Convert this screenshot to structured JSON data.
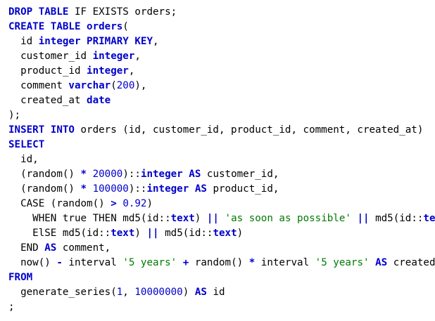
{
  "editor": {
    "theme": {
      "keyword_color": "#0000cc",
      "number_color": "#0000cc",
      "string_color": "#007a00",
      "text_color": "#000000",
      "background": "#ffffff"
    },
    "lines": [
      [
        {
          "t": "kw",
          "v": "DROP TABLE"
        },
        {
          "t": "plain",
          "v": " IF EXISTS orders;"
        }
      ],
      [
        {
          "t": "kw",
          "v": "CREATE TABLE"
        },
        {
          "t": "plain",
          "v": " "
        },
        {
          "t": "kw",
          "v": "orders"
        },
        {
          "t": "plain",
          "v": "("
        }
      ],
      [
        {
          "t": "plain",
          "v": "  id "
        },
        {
          "t": "kw",
          "v": "integer PRIMARY KEY"
        },
        {
          "t": "plain",
          "v": ","
        }
      ],
      [
        {
          "t": "plain",
          "v": "  customer_id "
        },
        {
          "t": "kw",
          "v": "integer"
        },
        {
          "t": "plain",
          "v": ","
        }
      ],
      [
        {
          "t": "plain",
          "v": "  product_id "
        },
        {
          "t": "kw",
          "v": "integer"
        },
        {
          "t": "plain",
          "v": ","
        }
      ],
      [
        {
          "t": "plain",
          "v": "  comment "
        },
        {
          "t": "kw",
          "v": "varchar"
        },
        {
          "t": "plain",
          "v": "("
        },
        {
          "t": "num",
          "v": "200"
        },
        {
          "t": "plain",
          "v": "),"
        }
      ],
      [
        {
          "t": "plain",
          "v": "  created_at "
        },
        {
          "t": "kw",
          "v": "date"
        }
      ],
      [
        {
          "t": "plain",
          "v": ");"
        }
      ],
      [
        {
          "t": "kw",
          "v": "INSERT INTO"
        },
        {
          "t": "plain",
          "v": " orders (id, customer_id, product_id, comment, created_at)"
        }
      ],
      [
        {
          "t": "kw",
          "v": "SELECT"
        }
      ],
      [
        {
          "t": "plain",
          "v": "  id,"
        }
      ],
      [
        {
          "t": "plain",
          "v": "  (random() "
        },
        {
          "t": "op",
          "v": "*"
        },
        {
          "t": "plain",
          "v": " "
        },
        {
          "t": "num",
          "v": "20000"
        },
        {
          "t": "plain",
          "v": ")::"
        },
        {
          "t": "kw",
          "v": "integer"
        },
        {
          "t": "plain",
          "v": " "
        },
        {
          "t": "kw",
          "v": "AS"
        },
        {
          "t": "plain",
          "v": " customer_id,"
        }
      ],
      [
        {
          "t": "plain",
          "v": "  (random() "
        },
        {
          "t": "op",
          "v": "*"
        },
        {
          "t": "plain",
          "v": " "
        },
        {
          "t": "num",
          "v": "100000"
        },
        {
          "t": "plain",
          "v": ")::"
        },
        {
          "t": "kw",
          "v": "integer"
        },
        {
          "t": "plain",
          "v": " "
        },
        {
          "t": "kw",
          "v": "AS"
        },
        {
          "t": "plain",
          "v": " product_id,"
        }
      ],
      [
        {
          "t": "plain",
          "v": "  CASE (random() "
        },
        {
          "t": "op",
          "v": ">"
        },
        {
          "t": "plain",
          "v": " "
        },
        {
          "t": "num",
          "v": "0.92"
        },
        {
          "t": "plain",
          "v": ")"
        }
      ],
      [
        {
          "t": "plain",
          "v": "    WHEN true THEN md5(id::"
        },
        {
          "t": "kw",
          "v": "text"
        },
        {
          "t": "plain",
          "v": ") "
        },
        {
          "t": "op",
          "v": "||"
        },
        {
          "t": "plain",
          "v": " "
        },
        {
          "t": "str",
          "v": "'as soon as possible'"
        },
        {
          "t": "plain",
          "v": " "
        },
        {
          "t": "op",
          "v": "||"
        },
        {
          "t": "plain",
          "v": " md5(id::"
        },
        {
          "t": "kw",
          "v": "text"
        },
        {
          "t": "plain",
          "v": ")"
        }
      ],
      [
        {
          "t": "plain",
          "v": "    ElSE md5(id::"
        },
        {
          "t": "kw",
          "v": "text"
        },
        {
          "t": "plain",
          "v": ") "
        },
        {
          "t": "op",
          "v": "||"
        },
        {
          "t": "plain",
          "v": " md5(id::"
        },
        {
          "t": "kw",
          "v": "text"
        },
        {
          "t": "plain",
          "v": ")"
        }
      ],
      [
        {
          "t": "plain",
          "v": "  END "
        },
        {
          "t": "kw",
          "v": "AS"
        },
        {
          "t": "plain",
          "v": " comment,"
        }
      ],
      [
        {
          "t": "plain",
          "v": "  now() "
        },
        {
          "t": "op",
          "v": "-"
        },
        {
          "t": "plain",
          "v": " interval "
        },
        {
          "t": "str",
          "v": "'5 years'"
        },
        {
          "t": "plain",
          "v": " "
        },
        {
          "t": "op",
          "v": "+"
        },
        {
          "t": "plain",
          "v": " random() "
        },
        {
          "t": "op",
          "v": "*"
        },
        {
          "t": "plain",
          "v": " interval "
        },
        {
          "t": "str",
          "v": "'5 years'"
        },
        {
          "t": "plain",
          "v": " "
        },
        {
          "t": "kw",
          "v": "AS"
        },
        {
          "t": "plain",
          "v": " created_at"
        }
      ],
      [
        {
          "t": "kw",
          "v": "FROM"
        }
      ],
      [
        {
          "t": "plain",
          "v": "  generate_series("
        },
        {
          "t": "num",
          "v": "1"
        },
        {
          "t": "plain",
          "v": ", "
        },
        {
          "t": "num",
          "v": "10000000"
        },
        {
          "t": "plain",
          "v": ") "
        },
        {
          "t": "kw",
          "v": "AS"
        },
        {
          "t": "plain",
          "v": " id"
        }
      ],
      [
        {
          "t": "plain",
          "v": ";"
        }
      ]
    ]
  }
}
